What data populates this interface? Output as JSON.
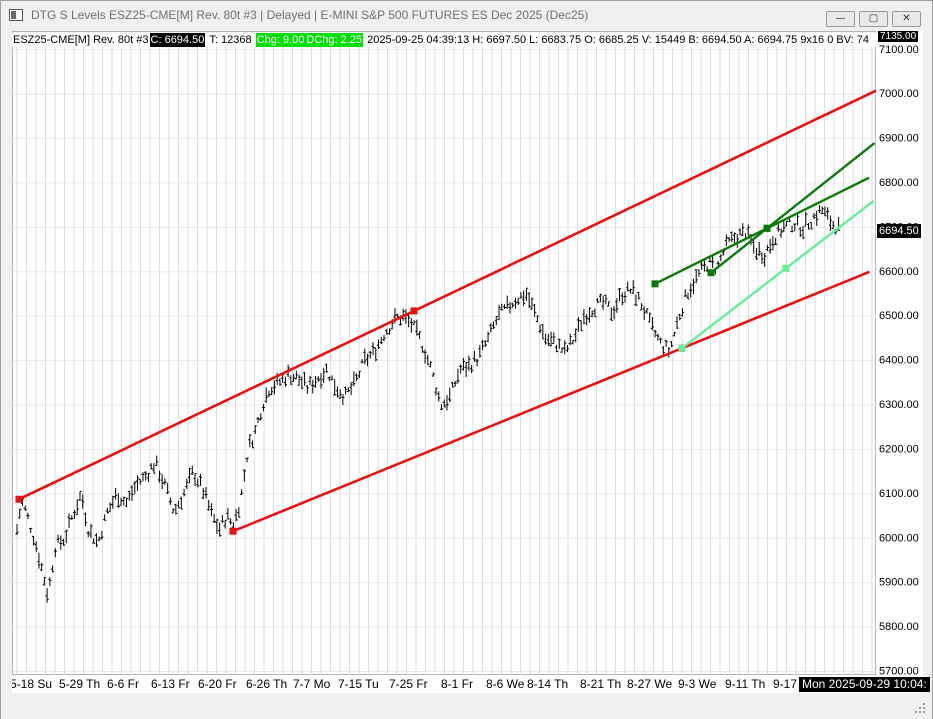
{
  "window": {
    "title": "DTG S Levels ESZ25-CME[M]  Rev. 80t #3 | Delayed | E-MINI S&P 500 FUTURES ES Dec 2025 (Dec25)",
    "buttons": {
      "minimize": "—",
      "maximize": "▢",
      "close": "✕"
    }
  },
  "infobar": {
    "symbol": "ESZ25-CME[M]  Rev. 80t #3",
    "close": "C: 6694.50",
    "time": "T: 12368",
    "chg": "Chg: 9.00",
    "dchg": "DChg: 2.25",
    "rest": "2025-09-25 04:39:13 H: 6697.50 L: 6683.75 O: 6685.25 V: 15449 B: 6694.50 A: 6694.75 9x16 0 BV: 74"
  },
  "axis": {
    "top_clipped_label": "7135.00",
    "current_price_label": "6694.50",
    "date_stamp": "Mon 2025-09-29  10:04:"
  },
  "colors": {
    "channel": "#e81010",
    "dark_green": "#0a7a0a",
    "light_green": "#66ee99",
    "bars": "#000000",
    "grid": "#d6d6d6"
  },
  "chart_data": {
    "type": "ohlc-bars",
    "y_range": [
      5690,
      7140
    ],
    "y_ticks": [
      5700,
      5800,
      5900,
      6000,
      6100,
      6200,
      6300,
      6400,
      6500,
      6600,
      6700,
      6800,
      6900,
      7000,
      7100
    ],
    "y_tick_labels": [
      "5700.00",
      "5800.00",
      "5900.00",
      "6000.00",
      "6100.00",
      "6200.00",
      "6300.00",
      "6400.00",
      "6500.00",
      "6600.00",
      "6700.00",
      "6800.00",
      "6900.00",
      "7000.00",
      "7100.00"
    ],
    "x_labels": [
      "5-18 Su",
      "5-29 Th",
      "6-6 Fr",
      "6-13 Fr",
      "6-20 Fr",
      "6-26 Th",
      "7-7 Mo",
      "7-15 Tu",
      "7-25 Fr",
      "8-1 Fr",
      "8-6 We",
      "8-14 Th",
      "8-21 Th",
      "8-27 We",
      "9-3 We",
      "9-11 Th",
      "9-17"
    ],
    "price_path": [
      [
        0,
        6020
      ],
      [
        2,
        6085
      ],
      [
        5,
        6040
      ],
      [
        8,
        5985
      ],
      [
        11,
        5920
      ],
      [
        13,
        5870
      ],
      [
        16,
        5980
      ],
      [
        20,
        6000
      ],
      [
        24,
        6060
      ],
      [
        27,
        6100
      ],
      [
        30,
        6020
      ],
      [
        34,
        5990
      ],
      [
        38,
        6060
      ],
      [
        42,
        6100
      ],
      [
        46,
        6080
      ],
      [
        50,
        6120
      ],
      [
        54,
        6140
      ],
      [
        58,
        6170
      ],
      [
        62,
        6120
      ],
      [
        66,
        6060
      ],
      [
        70,
        6100
      ],
      [
        74,
        6150
      ],
      [
        78,
        6110
      ],
      [
        82,
        6050
      ],
      [
        85,
        6020
      ],
      [
        88,
        6050
      ],
      [
        91,
        6030
      ],
      [
        94,
        6090
      ],
      [
        97,
        6200
      ],
      [
        100,
        6240
      ],
      [
        103,
        6300
      ],
      [
        106,
        6340
      ],
      [
        110,
        6350
      ],
      [
        114,
        6370
      ],
      [
        118,
        6360
      ],
      [
        122,
        6340
      ],
      [
        126,
        6360
      ],
      [
        130,
        6380
      ],
      [
        134,
        6340
      ],
      [
        138,
        6320
      ],
      [
        142,
        6350
      ],
      [
        146,
        6400
      ],
      [
        150,
        6420
      ],
      [
        154,
        6460
      ],
      [
        158,
        6490
      ],
      [
        162,
        6500
      ],
      [
        166,
        6480
      ],
      [
        170,
        6440
      ],
      [
        174,
        6380
      ],
      [
        178,
        6300
      ],
      [
        182,
        6320
      ],
      [
        186,
        6380
      ],
      [
        190,
        6390
      ],
      [
        194,
        6410
      ],
      [
        198,
        6450
      ],
      [
        202,
        6500
      ],
      [
        206,
        6520
      ],
      [
        210,
        6540
      ],
      [
        214,
        6550
      ],
      [
        218,
        6500
      ],
      [
        222,
        6450
      ],
      [
        226,
        6440
      ],
      [
        230,
        6420
      ],
      [
        234,
        6450
      ],
      [
        238,
        6500
      ],
      [
        242,
        6520
      ],
      [
        246,
        6530
      ],
      [
        250,
        6510
      ],
      [
        254,
        6550
      ],
      [
        258,
        6560
      ],
      [
        262,
        6530
      ],
      [
        266,
        6480
      ],
      [
        270,
        6440
      ],
      [
        274,
        6420
      ],
      [
        278,
        6500
      ],
      [
        282,
        6560
      ],
      [
        286,
        6590
      ],
      [
        290,
        6620
      ],
      [
        294,
        6610
      ],
      [
        298,
        6660
      ],
      [
        302,
        6680
      ],
      [
        306,
        6690
      ],
      [
        310,
        6650
      ],
      [
        314,
        6640
      ],
      [
        318,
        6680
      ],
      [
        322,
        6700
      ],
      [
        326,
        6710
      ],
      [
        330,
        6700
      ],
      [
        334,
        6720
      ],
      [
        338,
        6740
      ],
      [
        342,
        6710
      ],
      [
        346,
        6694
      ]
    ],
    "red_channel_upper": {
      "anchor1": [
        "5-15",
        6088
      ],
      "anchor2": [
        "7-25",
        6512
      ],
      "extends_to": 7010
    },
    "red_channel_lower": {
      "anchor1": [
        "6-23",
        6016
      ],
      "anchor2": [
        "9-2",
        6428
      ],
      "extends_to": 6600
    },
    "dark_green_line_upper": {
      "anchor1": [
        "9-4",
        6598
      ],
      "anchor2": [
        "9-15",
        6698
      ],
      "extends_to": 6890
    },
    "dark_green_line_lower": {
      "anchor1": [
        "8-28",
        6573
      ],
      "anchor2": [
        "9-15",
        6698
      ],
      "extends_to": 6812
    },
    "light_green_line": {
      "anchor1": [
        "9-2",
        6428
      ],
      "anchor2": [
        "9-19",
        6608
      ],
      "extends_to": 6760
    }
  }
}
